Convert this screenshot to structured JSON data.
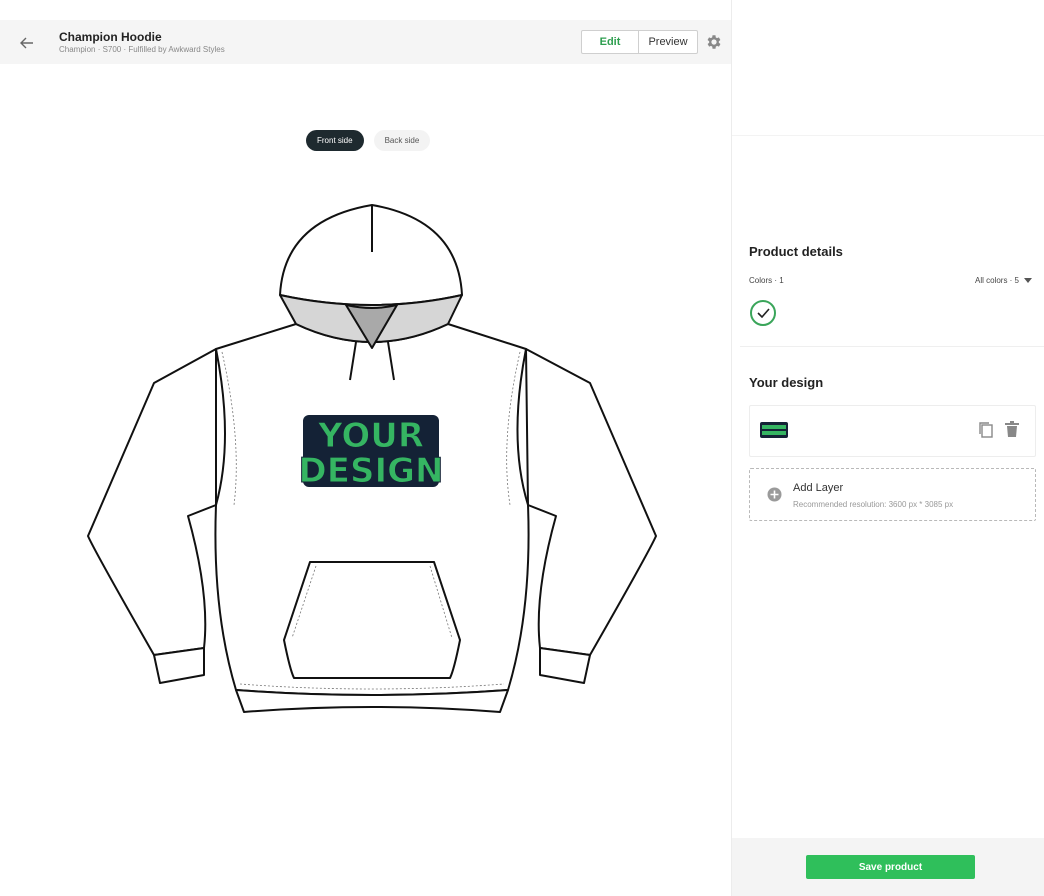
{
  "header": {
    "title": "Champion Hoodie",
    "subtitle": "Champion · S700 · Fulfilled by Awkward Styles",
    "edit_label": "Edit",
    "preview_label": "Preview"
  },
  "icons": {
    "back": "arrow-left-icon",
    "settings": "gear-icon",
    "check": "check-icon",
    "dropdown": "caret-down-icon",
    "copy": "copy-icon",
    "delete": "trash-icon",
    "add": "plus-circle-icon"
  },
  "canvas": {
    "tabs": [
      {
        "label": "Front side",
        "active": true
      },
      {
        "label": "Back side",
        "active": false
      }
    ],
    "design_text_line1": "YOUR",
    "design_text_line2": "DESIGN"
  },
  "panel": {
    "details_heading": "Product details",
    "colors_label": "Colors · 1",
    "all_colors_label": "All colors · 5",
    "design_heading": "Your design",
    "layer_thumb_text": "YOUR DESIGN",
    "add_layer_title": "Add Layer",
    "add_layer_hint": "Recommended resolution: 3600 px * 3085 px",
    "save_label": "Save product"
  },
  "colors": {
    "accent_green": "#2fbf5b",
    "edit_green": "#2e9e4f",
    "swatch_border": "#3aa55a",
    "design_green": "#35b562",
    "design_navy": "#142236",
    "tab_active": "#1e2a2f"
  }
}
